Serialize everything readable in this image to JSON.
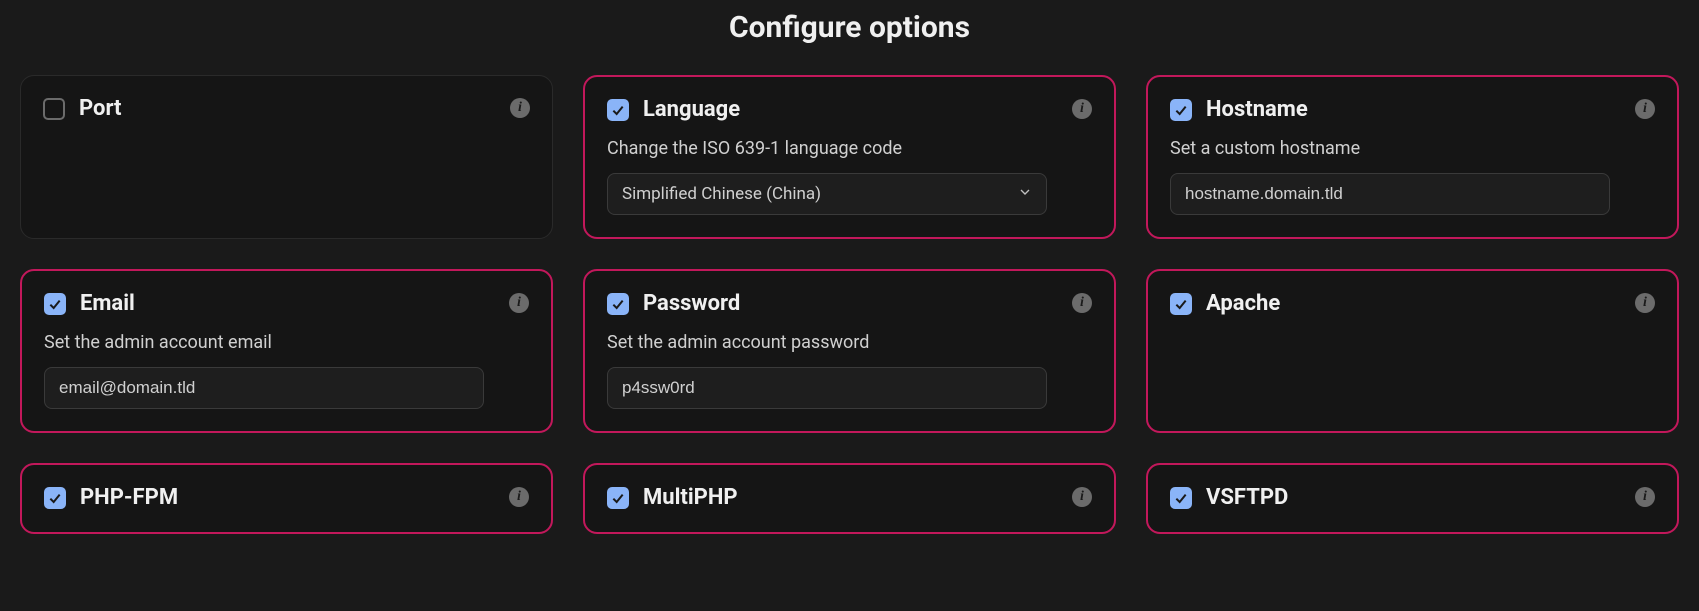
{
  "title": "Configure options",
  "cards": {
    "port": {
      "label": "Port",
      "checked": false
    },
    "language": {
      "label": "Language",
      "checked": true,
      "desc": "Change the ISO 639-1 language code",
      "select_value": "Simplified Chinese (China)"
    },
    "hostname": {
      "label": "Hostname",
      "checked": true,
      "desc": "Set a custom hostname",
      "input_value": "hostname.domain.tld"
    },
    "email": {
      "label": "Email",
      "checked": true,
      "desc": "Set the admin account email",
      "input_value": "email@domain.tld"
    },
    "password": {
      "label": "Password",
      "checked": true,
      "desc": "Set the admin account password",
      "input_value": "p4ssw0rd"
    },
    "apache": {
      "label": "Apache",
      "checked": true
    },
    "phpfpm": {
      "label": "PHP-FPM",
      "checked": true
    },
    "multiphp": {
      "label": "MultiPHP",
      "checked": true
    },
    "vsftpd": {
      "label": "VSFTPD",
      "checked": true
    }
  },
  "info_glyph": "i"
}
